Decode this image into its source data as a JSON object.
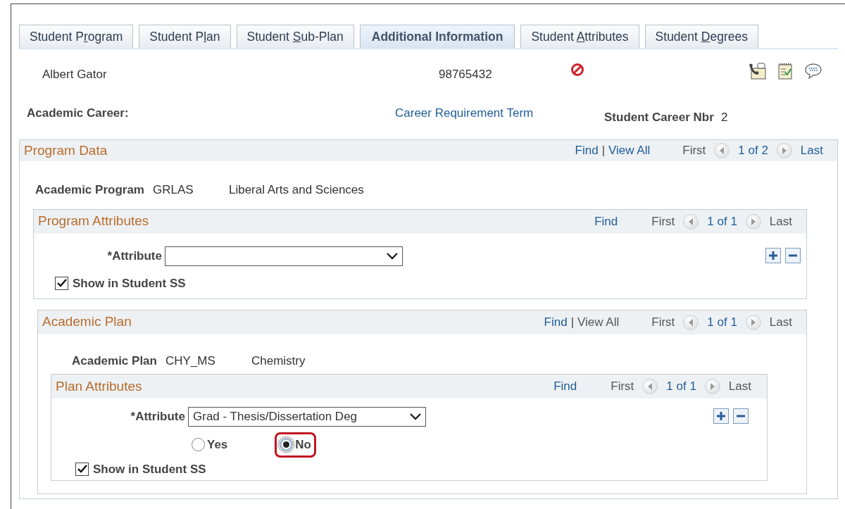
{
  "tabs": [
    {
      "label": [
        "Student P",
        "r",
        "ogram"
      ],
      "selected": false
    },
    {
      "label": [
        "Student P",
        "l",
        "an"
      ],
      "selected": false
    },
    {
      "label": [
        "Student ",
        "S",
        "ub-Plan"
      ],
      "selected": false
    },
    {
      "label": [
        "Additional Information"
      ],
      "selected": true
    },
    {
      "label": [
        "Student ",
        "A",
        "ttributes"
      ],
      "selected": false
    },
    {
      "label": [
        "Student ",
        "D",
        "egrees"
      ],
      "selected": false
    }
  ],
  "student": {
    "name": "Albert Gator",
    "id": "98765432"
  },
  "career": {
    "label": "Academic Career:",
    "link": "Career Requirement Term",
    "nbr_label": "Student Career Nbr",
    "nbr_value": "2"
  },
  "program_data": {
    "title": "Program Data",
    "nav": {
      "find": "Find",
      "separator": "|",
      "view_all": {
        "text": "View All",
        "disabled": false
      },
      "first": {
        "text": "First",
        "disabled": true
      },
      "counter": "1 of 2",
      "last": {
        "text": "Last",
        "disabled": false
      }
    },
    "row": {
      "label": "Academic Program",
      "code": "GRLAS",
      "description": "Liberal Arts and Sciences"
    },
    "program_attributes": {
      "title": "Program Attributes",
      "nav": {
        "find": "Find",
        "first": {
          "text": "First",
          "disabled": true
        },
        "counter": "1 of 1",
        "last": {
          "text": "Last",
          "disabled": true
        }
      },
      "attribute": {
        "label": "*Attribute"
      },
      "show": {
        "label": "Show in Student SS",
        "checked": true
      }
    },
    "academic_plan": {
      "title": "Academic Plan",
      "nav": {
        "find": "Find",
        "separator": "|",
        "view_all": {
          "text": "View All",
          "disabled": true
        },
        "first": {
          "text": "First",
          "disabled": true
        },
        "counter": "1 of 1",
        "last": {
          "text": "Last",
          "disabled": true
        }
      },
      "row": {
        "label": "Academic Plan",
        "code": "CHY_MS",
        "description": "Chemistry"
      },
      "plan_attributes": {
        "title": "Plan Attributes",
        "nav": {
          "find": "Find",
          "first": {
            "text": "First",
            "disabled": true
          },
          "counter": "1 of 1",
          "last": {
            "text": "Last",
            "disabled": true
          }
        },
        "attribute": {
          "label": "*Attribute",
          "value": "Grad - Thesis/Dissertation Deg"
        },
        "options": [
          {
            "label": "Yes",
            "selected": false,
            "kind": "plain"
          },
          {
            "label": "No",
            "selected": true,
            "kind": "annotated"
          }
        ],
        "show": {
          "label": "Show in Student SS",
          "checked": true
        }
      }
    }
  }
}
